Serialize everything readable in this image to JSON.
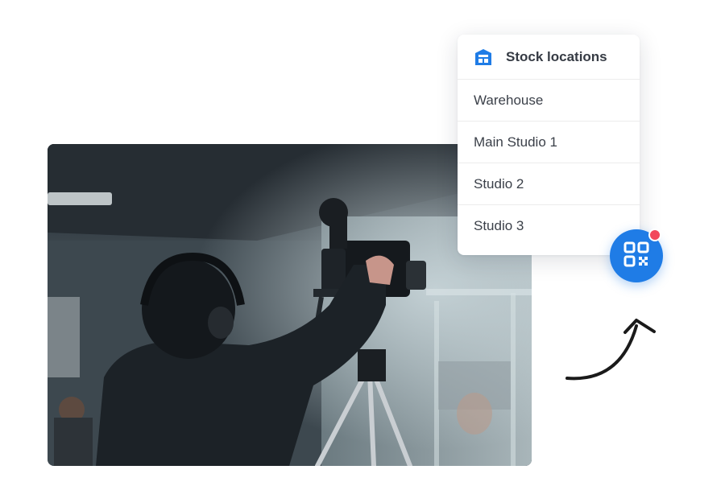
{
  "dropdown": {
    "title": "Stock locations",
    "icon": "warehouse-icon",
    "items": [
      {
        "label": "Warehouse"
      },
      {
        "label": "Main Studio 1"
      },
      {
        "label": "Studio 2"
      },
      {
        "label": "Studio 3"
      }
    ]
  },
  "qr_button": {
    "icon": "qr-code-icon",
    "notification": true
  },
  "colors": {
    "accent": "#1f7ce6",
    "notification": "#f2475b",
    "text": "#3b4049"
  }
}
